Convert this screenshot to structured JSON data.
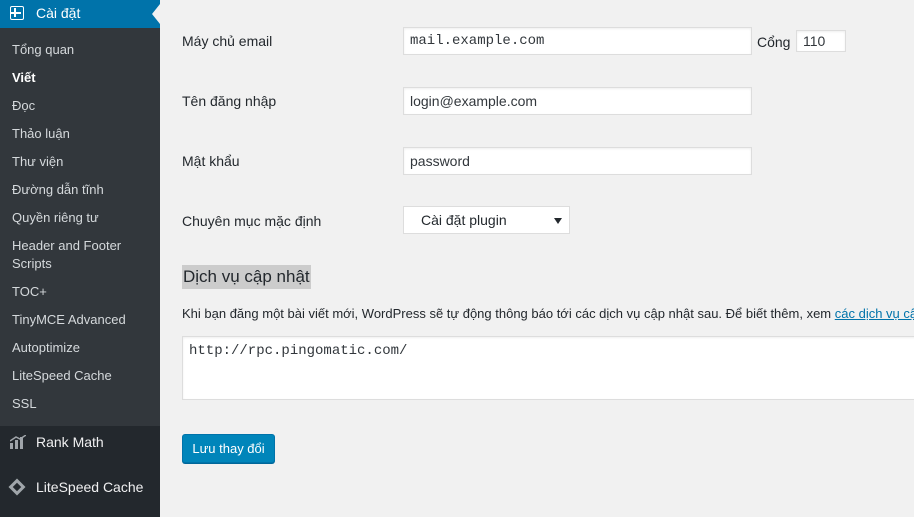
{
  "sidebar": {
    "settings_label": "Cài đặt",
    "submenu": [
      {
        "label": "Tổng quan"
      },
      {
        "label": "Viết"
      },
      {
        "label": "Đọc"
      },
      {
        "label": "Thảo luận"
      },
      {
        "label": "Thư viện"
      },
      {
        "label": "Đường dẫn tĩnh"
      },
      {
        "label": "Quyền riêng tư"
      },
      {
        "label": "Header and Footer Scripts"
      },
      {
        "label": "TOC+"
      },
      {
        "label": "TinyMCE Advanced"
      },
      {
        "label": "Autoptimize"
      },
      {
        "label": "LiteSpeed Cache"
      },
      {
        "label": "SSL"
      }
    ],
    "main_items": [
      {
        "label": "Rank Math",
        "icon": "rank-math-icon"
      },
      {
        "label": "LiteSpeed Cache",
        "icon": "litespeed-icon"
      }
    ]
  },
  "form": {
    "mail_server_label": "Máy chủ email",
    "mail_server_value": "mail.example.com",
    "port_label": "Cổng",
    "port_value": "110",
    "username_label": "Tên đăng nhập",
    "username_value": "login@example.com",
    "password_label": "Mật khẩu",
    "password_value": "password",
    "category_label": "Chuyên mục mặc định",
    "category_value": "Cài đặt plugin"
  },
  "update_services": {
    "title": "Dịch vụ cập nhật",
    "description": "Khi bạn đăng một bài viết mới, WordPress sẽ tự động thông báo tới các dịch vụ cập nhật sau. Để biết thêm, xem ",
    "link_text": "các dịch vụ cập nhật",
    "services_value": "http://rpc.pingomatic.com/"
  },
  "save_label": "Lưu thay đổi",
  "colors": {
    "sidebar": "#23282d",
    "submenu": "#32373c",
    "accent": "#0073aa",
    "button": "#0085ba"
  }
}
